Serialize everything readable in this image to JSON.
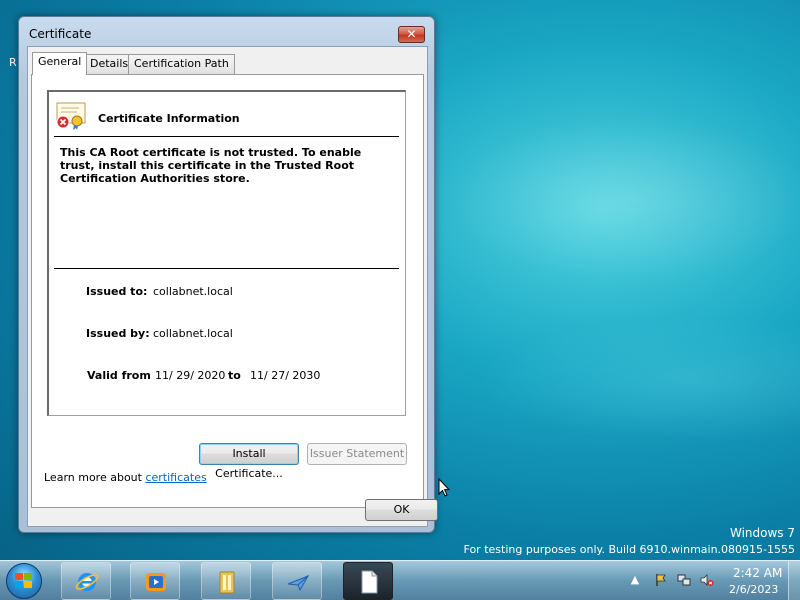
{
  "desktop": {
    "partial_label": "R"
  },
  "window": {
    "title": "Certificate",
    "close_glyph": "✕",
    "tabs": [
      {
        "label": "General",
        "active": true
      },
      {
        "label": "Details",
        "active": false
      },
      {
        "label": "Certification Path",
        "active": false
      }
    ],
    "info": {
      "heading": "Certificate Information",
      "warning": "This CA Root certificate is not trusted. To enable trust, install this certificate in the Trusted Root Certification Authorities store.",
      "issued_to_label": "Issued to:",
      "issued_to_value": "collabnet.local",
      "issued_by_label": "Issued by:",
      "issued_by_value": "collabnet.local",
      "valid_from_label": "Valid from",
      "valid_from_value": "11/ 29/ 2020",
      "valid_to_label": "to",
      "valid_to_value": "11/ 27/ 2030"
    },
    "buttons": {
      "install": "Install Certificate...",
      "issuer_statement": "Issuer Statement",
      "ok": "OK"
    },
    "learn_more_prefix": "Learn more about ",
    "learn_more_link": "certificates"
  },
  "watermark": {
    "line1": "Windows 7",
    "line2": "For testing purposes only. Build 6910.winmain.080915-1555"
  },
  "taskbar": {
    "items": [
      {
        "name": "Internet Explorer",
        "icon": "ie-icon",
        "active": false
      },
      {
        "name": "Windows Media Player",
        "icon": "media-player-icon",
        "active": false
      },
      {
        "name": "Windows Explorer",
        "icon": "explorer-folder-icon",
        "active": false
      },
      {
        "name": "Paper Plane App",
        "icon": "paper-plane-icon",
        "active": false
      },
      {
        "name": "Document Window",
        "icon": "document-icon",
        "active": true
      }
    ],
    "tray_arrow": "▲",
    "clock_time": "2:42 AM",
    "clock_date": "2/6/2023"
  }
}
